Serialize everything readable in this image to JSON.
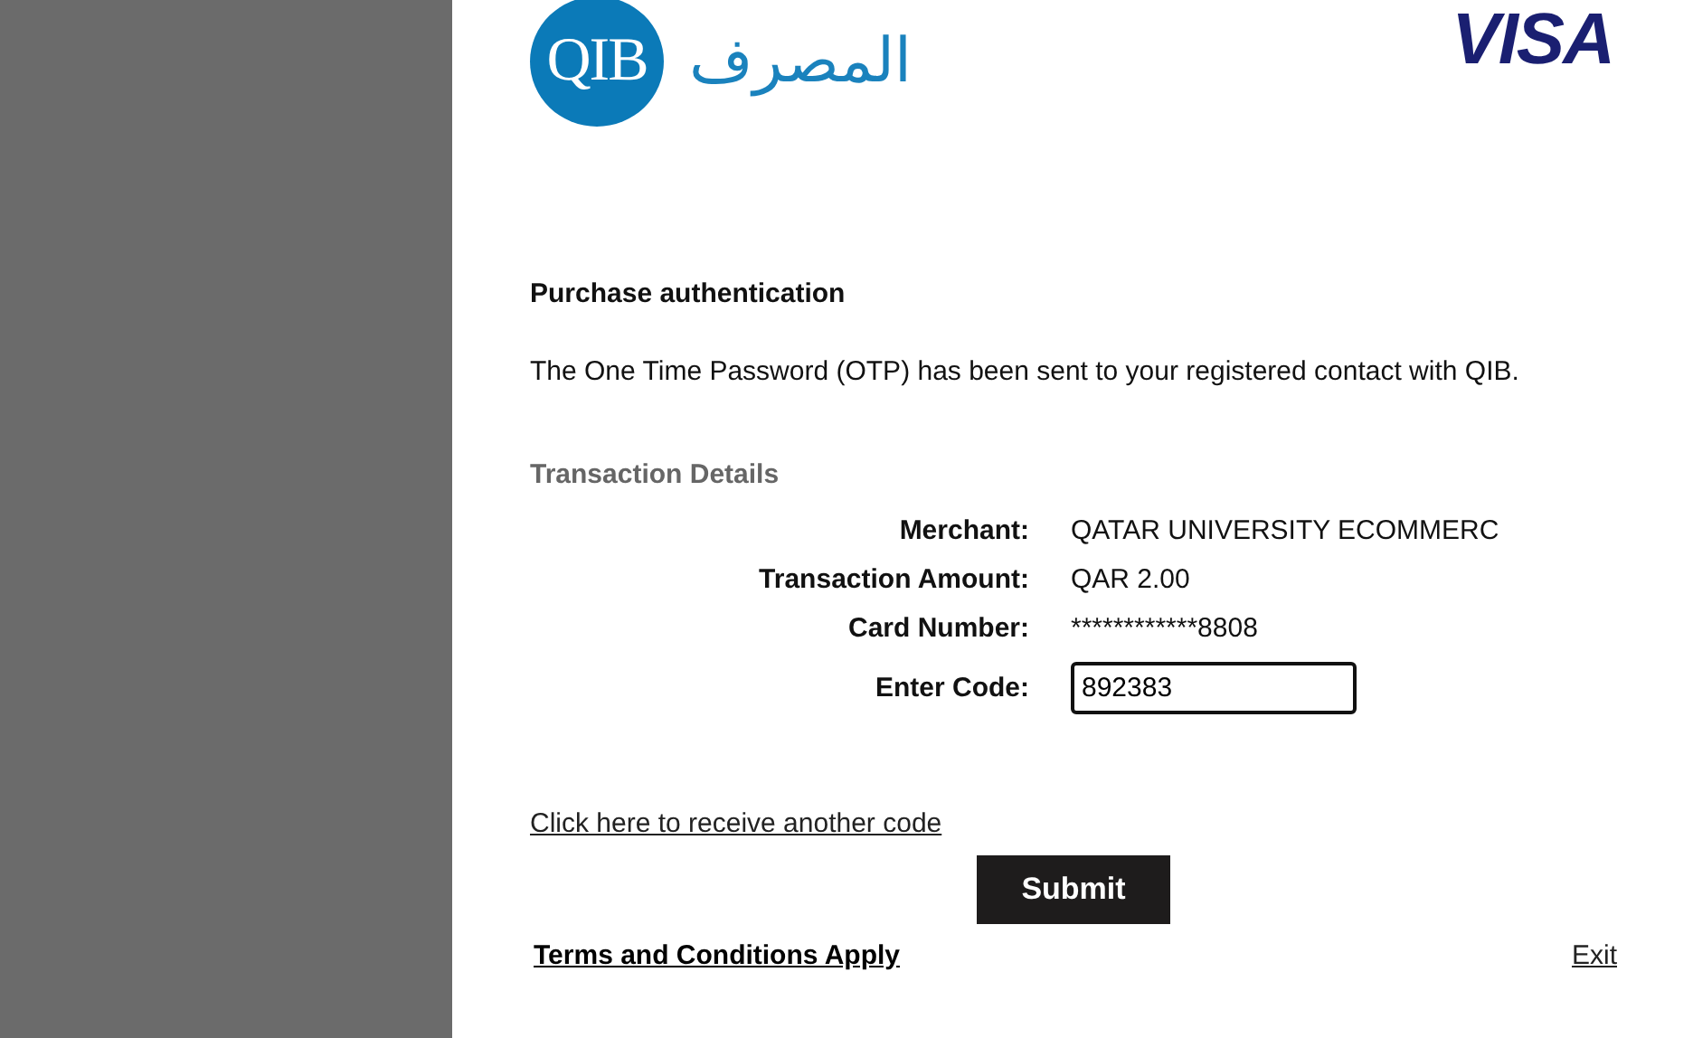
{
  "bank_logo": {
    "emblem": "QIB",
    "name": "المصرف"
  },
  "card_logo": "VISA",
  "heading": "Purchase authentication",
  "message": "The One Time Password (OTP) has been sent to your registered contact with QIB.",
  "details": {
    "title": "Transaction Details",
    "rows": [
      {
        "label": "Merchant:",
        "value": "QATAR UNIVERSITY ECOMMERC"
      },
      {
        "label": "Transaction Amount:",
        "value": "QAR 2.00"
      },
      {
        "label": "Card Number:",
        "value": "************8808"
      }
    ],
    "code": {
      "label": "Enter Code:",
      "value": "892383"
    }
  },
  "resend_link": "Click here to receive another code",
  "submit": "Submit",
  "terms_link": "Terms and Conditions Apply",
  "exit_link": "Exit"
}
